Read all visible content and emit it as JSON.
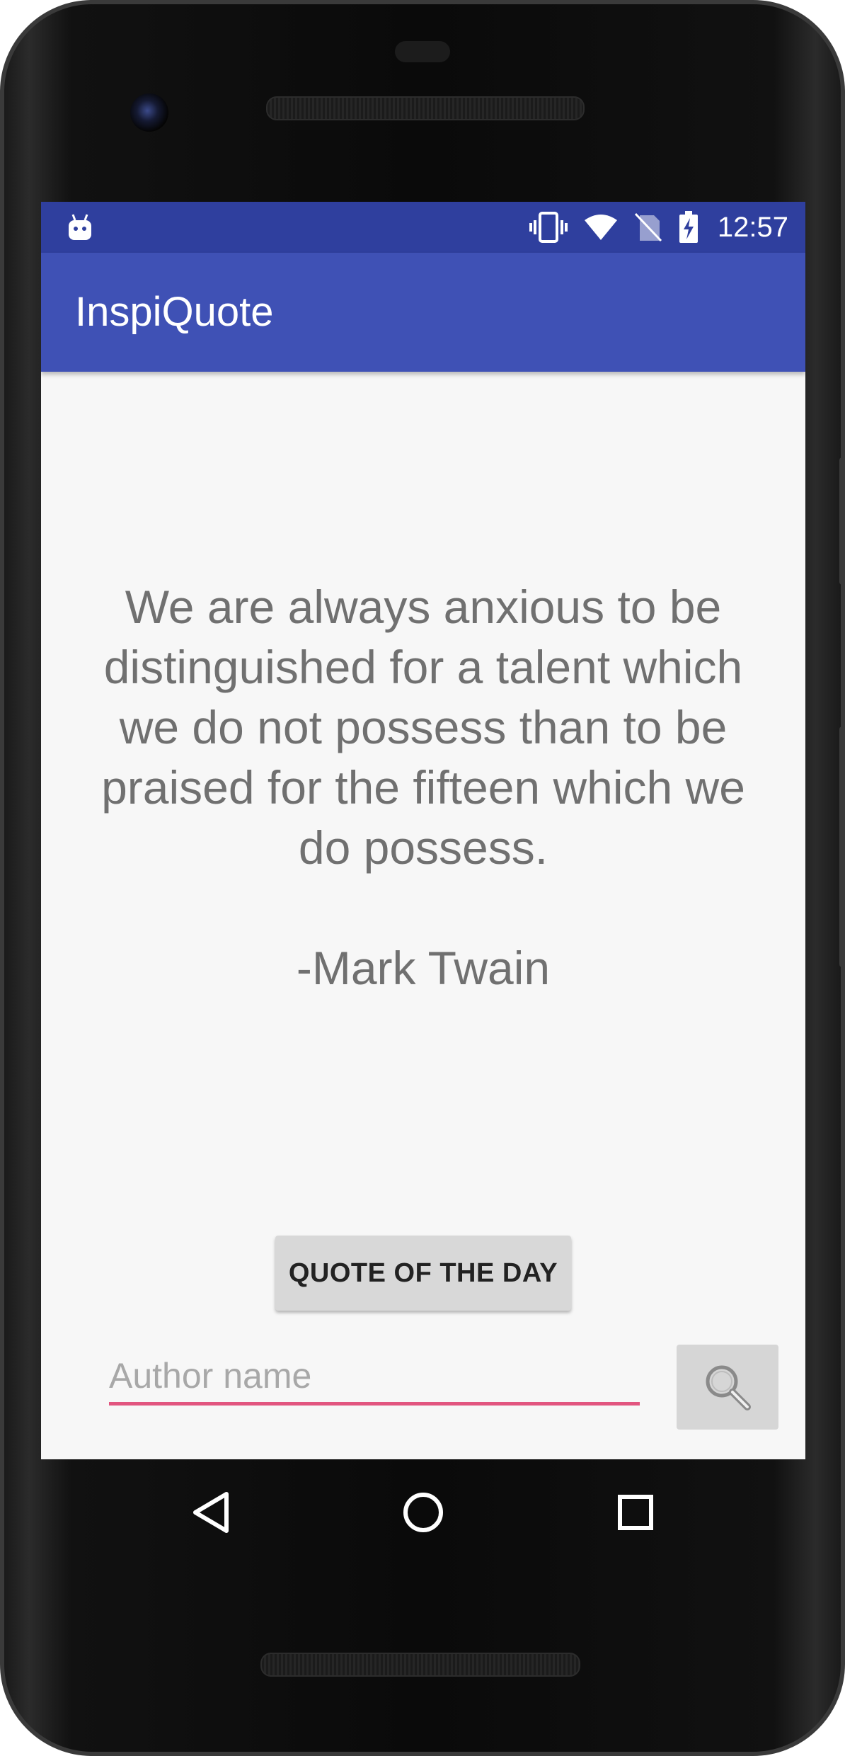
{
  "status_bar": {
    "time": "12:57",
    "icons": [
      "android-debug-icon",
      "vibrate-icon",
      "wifi-icon",
      "no-sim-icon",
      "battery-charging-icon"
    ],
    "color": "#2f3f9e"
  },
  "app_bar": {
    "title": "InspiQuote",
    "color": "#3f51b5"
  },
  "quote": {
    "lines": [
      "We are always anxious to be",
      "distinguished for a talent which",
      "we do not possess than to be",
      "praised for the fifteen which we",
      "do possess."
    ],
    "author": "-Mark Twain"
  },
  "actions": {
    "quote_of_the_day_label": "QUOTE OF THE DAY",
    "author_input": {
      "placeholder": "Author name",
      "value": ""
    },
    "search_icon": "search-icon",
    "accent_color": "#e2557f"
  },
  "nav_bar": {
    "icons": [
      "back-icon",
      "home-icon",
      "recents-icon"
    ]
  }
}
